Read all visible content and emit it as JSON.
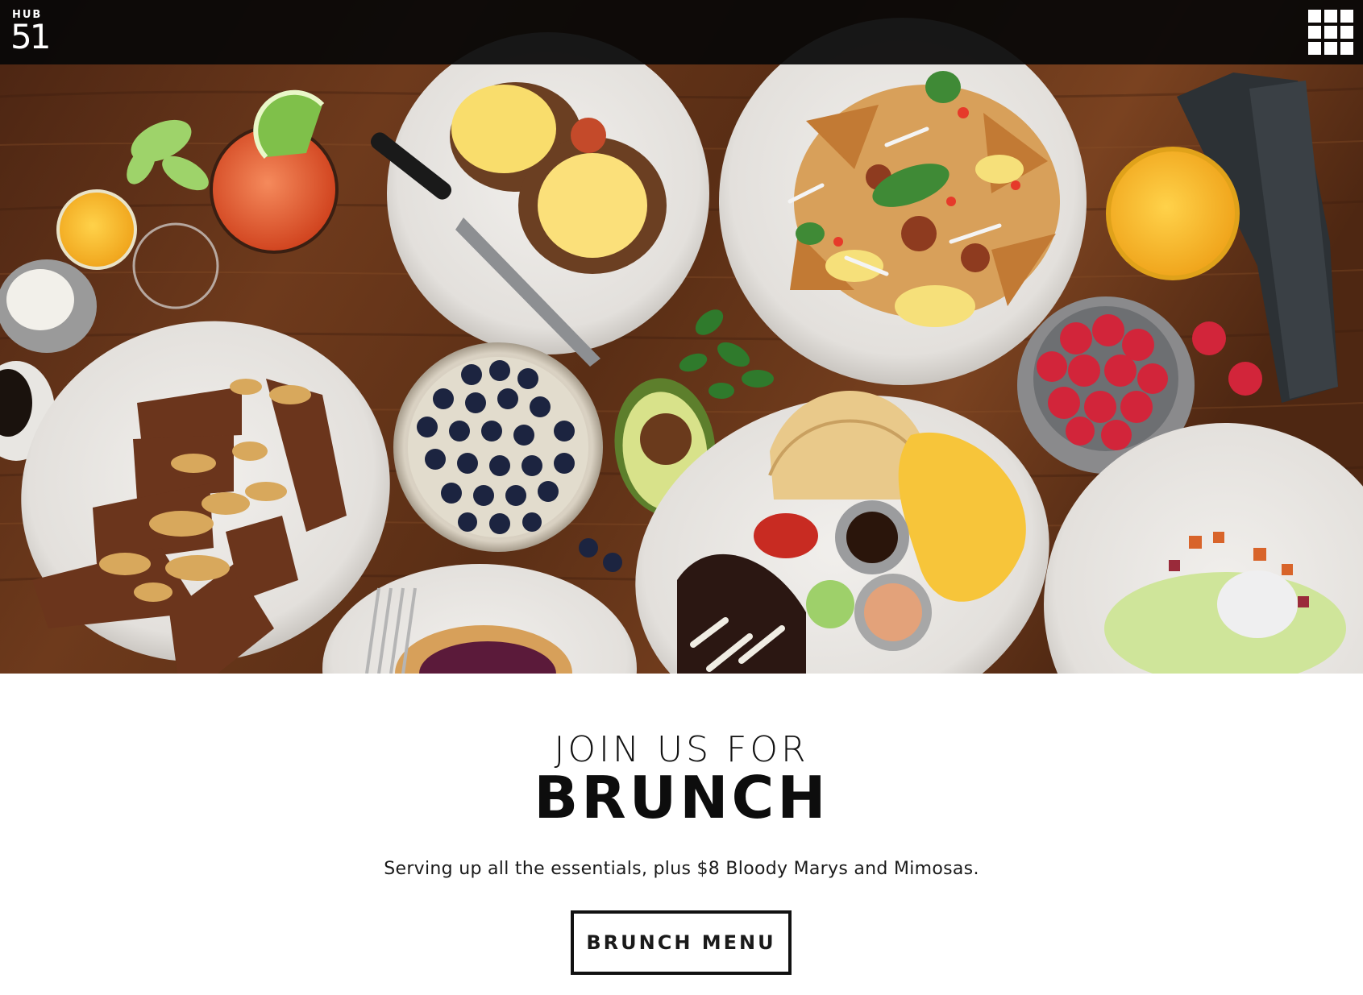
{
  "header": {
    "logo_top": "HUB",
    "logo_number": "51",
    "menu_icon": "grid-menu-icon"
  },
  "hero": {
    "image_alt": "Overhead view of a brunch spread on a wooden table"
  },
  "main": {
    "heading_small": "JOIN US FOR",
    "heading_big": "BRUNCH",
    "subtext": "Serving up all the essentials, plus $8 Bloody Marys and Mimosas.",
    "cta_label": "BRUNCH MENU"
  },
  "colors": {
    "topbar": "#080808",
    "text": "#111111",
    "background": "#ffffff"
  }
}
